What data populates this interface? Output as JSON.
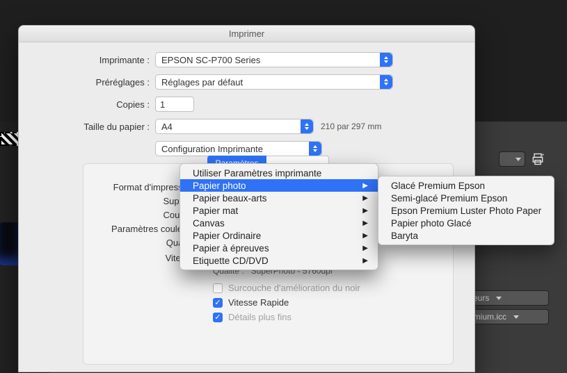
{
  "window": {
    "title": "Imprimer"
  },
  "fields": {
    "printer_label": "Imprimante :",
    "printer_value": "EPSON SC-P700 Series",
    "presets_label": "Préréglages :",
    "presets_value": "Réglages par défaut",
    "copies_label": "Copies :",
    "copies_value": "1",
    "paper_label": "Taille du papier :",
    "paper_value": "A4",
    "paper_dim": "210 par 297 mm",
    "section_value": "Configuration Imprimante"
  },
  "tabs": {
    "selected": "Paramètres",
    "other_partial": ""
  },
  "pane": {
    "print_format_label": "Format d'impression",
    "support_label": "Support",
    "color_label": "Couleur",
    "color_params_label": "Paramètres couleurs",
    "quality_label": "Qualité",
    "speed_label": "Vitesse",
    "slider_end": "Qualité",
    "quality_read_label": "Qualité :",
    "quality_read_value": "SuperPhoto - 5760dpi",
    "black_overlay": "Surcouche d'amélioration du noir",
    "fast_speed": "Vitesse Rapide",
    "finer_details": "Détails plus fins"
  },
  "menu": {
    "items": [
      {
        "label": "Utiliser Paramètres imprimante",
        "arrow": false
      },
      {
        "label": "Papier photo",
        "arrow": true,
        "hl": true
      },
      {
        "label": "Papier beaux-arts",
        "arrow": true
      },
      {
        "label": "Papier mat",
        "arrow": true
      },
      {
        "label": "Canvas",
        "arrow": true
      },
      {
        "label": "Papier Ordinaire",
        "arrow": true
      },
      {
        "label": "Papier à épreuves",
        "arrow": true
      },
      {
        "label": "Etiquette CD/DVD",
        "arrow": true
      }
    ]
  },
  "submenu": {
    "items": [
      "Glacé Premium Epson",
      "Semi-glacé Premium Epson",
      "Epson Premium Luster Photo Paper",
      "Papier photo Glacé",
      "Baryta"
    ]
  },
  "right_panel": {
    "field1_suffix": "eurs",
    "field2_suffix": "remium.icc"
  }
}
